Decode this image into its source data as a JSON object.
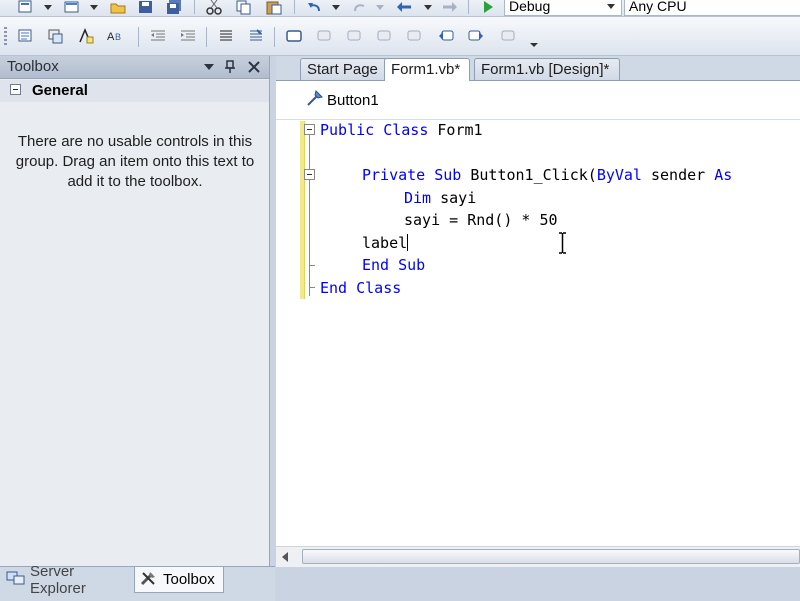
{
  "toolbar_top": {
    "config_combo": "Debug",
    "platform_combo": "Any CPU"
  },
  "toolbox": {
    "title": "Toolbox",
    "group_label": "General",
    "empty_message": "There are no usable controls in this group. Drag an item onto this text to add it to the toolbox."
  },
  "bottom_tabs": {
    "server_explorer": "Server Explorer",
    "toolbox": "Toolbox"
  },
  "doc_tabs": {
    "start_page": "Start Page",
    "form1_vb": "Form1.vb*",
    "form1_design": "Form1.vb [Design]*"
  },
  "nav_bar": {
    "object_combo": "Button1"
  },
  "code": {
    "line1_kw1": "Public Class",
    "line1_name": " Form1",
    "line3_kw1": "Private Sub",
    "line3_name": " Button1_Click(",
    "line3_kw2": "ByVal",
    "line3_rest": " sender ",
    "line3_kw3": "As",
    "line4_kw": "Dim",
    "line4_rest": " sayi",
    "line5": "sayi = Rnd() * 50",
    "line6": "label",
    "line7_kw": "End Sub",
    "line8_kw": "End Class"
  },
  "colors": {
    "keyword": "#0000ff",
    "change_bar": "#f1e98e"
  }
}
